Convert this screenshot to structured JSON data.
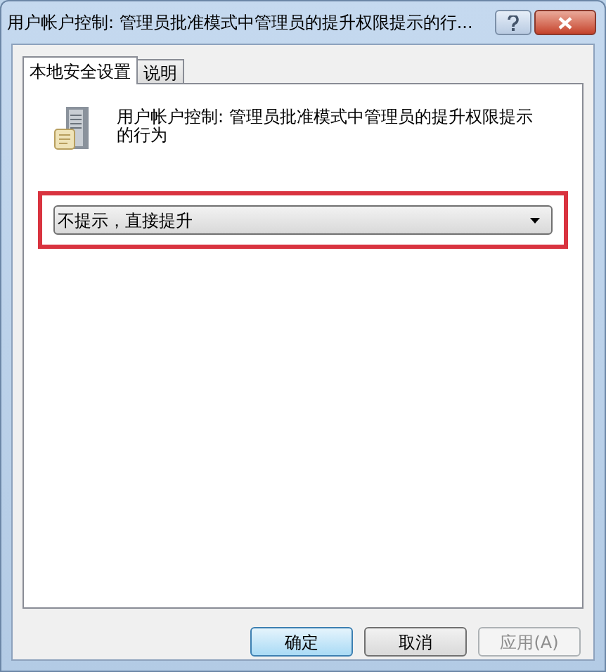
{
  "window": {
    "title": "用户帐户控制: 管理员批准模式中管理员的提升权限提示的行..."
  },
  "tabs": [
    {
      "label": "本地安全设置",
      "selected": true
    },
    {
      "label": "说明",
      "selected": false
    }
  ],
  "policy": {
    "name": "用户帐户控制: 管理员批准模式中管理员的提升权限提示的行为"
  },
  "dropdown": {
    "value": "不提示，直接提升",
    "highlighted": true
  },
  "buttons": [
    {
      "label": "确定",
      "default": true,
      "disabled": false
    },
    {
      "label": "取消",
      "default": false,
      "disabled": false
    },
    {
      "label": "应用(A)",
      "default": false,
      "disabled": true
    }
  ]
}
